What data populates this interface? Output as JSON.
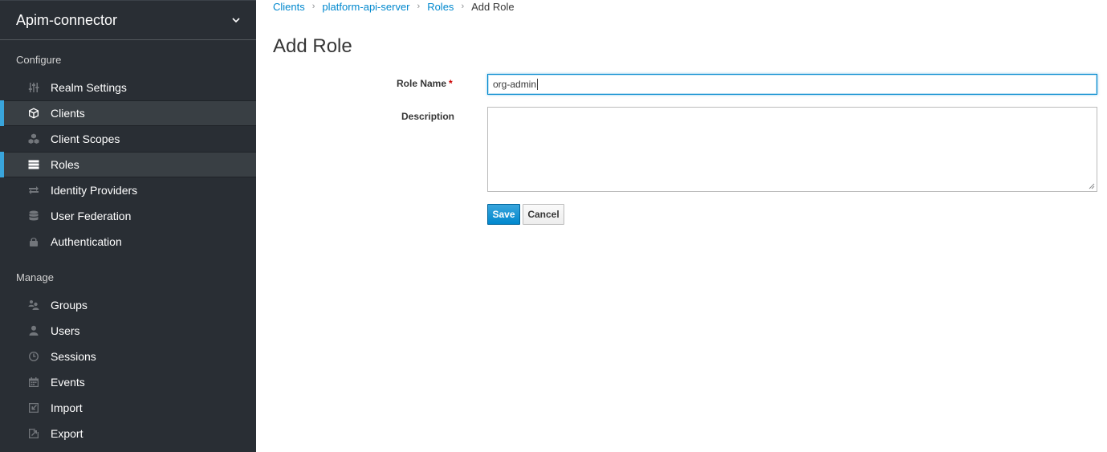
{
  "sidebar": {
    "realm_name": "Apim-connector",
    "configure_title": "Configure",
    "configure_items": [
      {
        "label": "Realm Settings",
        "icon": "sliders-icon",
        "active": false
      },
      {
        "label": "Clients",
        "icon": "cube-icon",
        "active": true
      },
      {
        "label": "Client Scopes",
        "icon": "cubes-icon",
        "active": false
      },
      {
        "label": "Roles",
        "icon": "list-icon",
        "active": true
      },
      {
        "label": "Identity Providers",
        "icon": "exchange-icon",
        "active": false
      },
      {
        "label": "User Federation",
        "icon": "database-icon",
        "active": false
      },
      {
        "label": "Authentication",
        "icon": "lock-icon",
        "active": false
      }
    ],
    "manage_title": "Manage",
    "manage_items": [
      {
        "label": "Groups",
        "icon": "users-group-icon"
      },
      {
        "label": "Users",
        "icon": "user-icon"
      },
      {
        "label": "Sessions",
        "icon": "clock-icon"
      },
      {
        "label": "Events",
        "icon": "calendar-icon"
      },
      {
        "label": "Import",
        "icon": "import-icon"
      },
      {
        "label": "Export",
        "icon": "export-icon"
      }
    ]
  },
  "breadcrumb": {
    "items": [
      "Clients",
      "platform-api-server",
      "Roles"
    ],
    "current": "Add Role"
  },
  "page_title": "Add Role",
  "form": {
    "role_name_label": "Role Name",
    "required_mark": "*",
    "role_name_value": "org-admin",
    "description_label": "Description",
    "description_value": "",
    "save_label": "Save",
    "cancel_label": "Cancel"
  },
  "colors": {
    "sidebar_bg": "#292e34",
    "active_accent": "#39a5dc",
    "link": "#0088ce",
    "primary_button": "#0088ce"
  }
}
